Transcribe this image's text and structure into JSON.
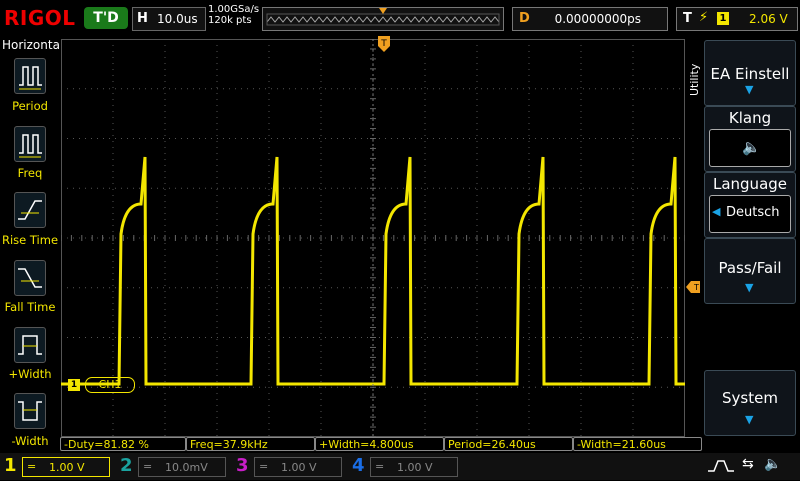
{
  "top": {
    "logo": "RIGOL",
    "mode": "T'D",
    "timebase_key": "H",
    "timebase_value": "10.0us",
    "sample_rate": "1.00GSa/s",
    "memory_depth": "120k pts",
    "delay_key": "D",
    "delay_value": "0.00000000ps",
    "trigger_key": "T",
    "trigger_channel": "1",
    "trigger_level": "2.06 V"
  },
  "left_menu": {
    "title": "Horizontal",
    "items": [
      {
        "label": "Period",
        "icon": "period-measure-icon"
      },
      {
        "label": "Freq",
        "icon": "frequency-measure-icon"
      },
      {
        "label": "Rise Time",
        "icon": "rise-time-icon"
      },
      {
        "label": "Fall Time",
        "icon": "fall-time-icon"
      },
      {
        "label": "+Width",
        "icon": "positive-width-icon"
      },
      {
        "label": "-Width",
        "icon": "negative-width-icon"
      }
    ]
  },
  "right_menu": {
    "tab": "Utility",
    "items": [
      {
        "label": "EA Einstell"
      },
      {
        "label": "Klang",
        "value_icon": "speaker-muted-icon"
      },
      {
        "label": "Language",
        "value": "Deutsch"
      },
      {
        "label": "Pass/Fail"
      },
      {
        "label": "System"
      }
    ]
  },
  "channel_marker": {
    "num": "1",
    "label": "CH1"
  },
  "measurements": [
    {
      "text": "-Duty=81.82 %"
    },
    {
      "text": "Freq=37.9kHz"
    },
    {
      "text": "+Width=4.800us"
    },
    {
      "text": "Period=26.40us"
    },
    {
      "text": "-Width=21.60us"
    }
  ],
  "channels": [
    {
      "num": "1",
      "coupling": "=",
      "scale": "1.00 V",
      "color": "#f3e600"
    },
    {
      "num": "2",
      "coupling": "=",
      "scale": "10.0mV",
      "color": "#1aa3a0"
    },
    {
      "num": "3",
      "coupling": "=",
      "scale": "1.00 V",
      "color": "#c81ec8"
    },
    {
      "num": "4",
      "coupling": "=",
      "scale": "1.00 V",
      "color": "#1a6ee6"
    }
  ],
  "colors": {
    "ch1": "#f3e600",
    "trigger": "#f0a020",
    "accent": "#1aa3e6"
  }
}
